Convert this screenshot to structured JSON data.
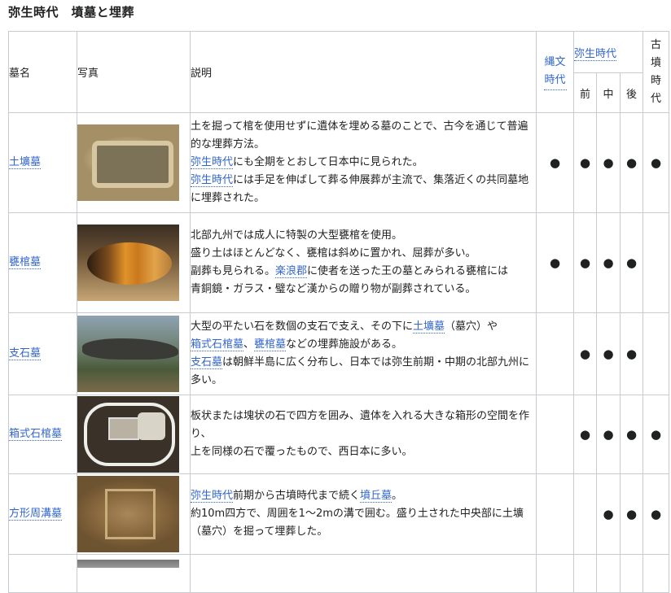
{
  "title": "弥生時代　墳墓と埋葬",
  "headers": {
    "name": "墓名",
    "photo": "写真",
    "desc": "説明",
    "jomon": "縄文時代",
    "yayoi": "弥生時代",
    "early": "前",
    "middle": "中",
    "late": "後",
    "kofun": "古墳時代"
  },
  "dot": "●",
  "rows": [
    {
      "name": "土壙墓",
      "desc": [
        {
          "text": "土を掘って棺を使用せずに遺体を埋める墓のことで、古今を通じて普遍的な埋葬方法。"
        },
        {
          "link": "弥生時代",
          "text": "にも全期をとおして日本中に見られた。"
        },
        {
          "link": "弥生時代",
          "text": "には手足を伸ばして葬る伸展葬が主流で、集落近くの共同墓地に埋葬された。"
        }
      ],
      "periods": {
        "jomon": true,
        "early": true,
        "middle": true,
        "late": true,
        "kofun": true
      }
    },
    {
      "name": "甕棺墓",
      "desc": [
        {
          "text": "北部九州では成人に特製の大型甕棺を使用。"
        },
        {
          "text": "盛り土はほとんどなく、甕棺は斜めに置かれ、屈葬が多い。"
        },
        {
          "text": "副葬も見られる。",
          "link": "楽浪郡",
          "text2": "に使者を送った王の墓とみられる甕棺には"
        },
        {
          "text": "青銅鏡・ガラス・璧など漢からの贈り物が副葬されている。"
        }
      ],
      "periods": {
        "jomon": true,
        "early": true,
        "middle": true,
        "late": true,
        "kofun": false
      }
    },
    {
      "name": "支石墓",
      "desc": [
        {
          "text": "大型の平たい石を数個の支石で支え、その下に",
          "link": "土壙墓",
          "text2": "（墓穴）や"
        },
        {
          "link": "箱式石棺墓",
          "text": "、",
          "link2": "甕棺墓",
          "text2": "などの埋葬施設がある。"
        },
        {
          "link": "支石墓",
          "text": "は朝鮮半島に広く分布し、日本では弥生前期・中期の北部九州に多い。"
        }
      ],
      "periods": {
        "jomon": false,
        "early": true,
        "middle": true,
        "late": true,
        "kofun": false
      }
    },
    {
      "name": "箱式石棺墓",
      "desc": [
        {
          "text": "板状または塊状の石で四方を囲み、遺体を入れる大きな箱形の空間を作り、"
        },
        {
          "text": "上を同様の石で覆ったもので、西日本に多い。"
        }
      ],
      "periods": {
        "jomon": false,
        "early": true,
        "middle": true,
        "late": true,
        "kofun": true
      }
    },
    {
      "name": "方形周溝墓",
      "desc": [
        {
          "link": "弥生時代",
          "text": "前期から古墳時代まで続く",
          "link2": "墳丘墓",
          "text2": "。"
        },
        {
          "text": "約10m四方で、周囲を1～2mの溝で囲む。盛り土された中央部に土壙（墓穴）を掘って埋葬した。"
        }
      ],
      "periods": {
        "jomon": false,
        "early": false,
        "middle": true,
        "late": true,
        "kofun": true
      }
    }
  ]
}
